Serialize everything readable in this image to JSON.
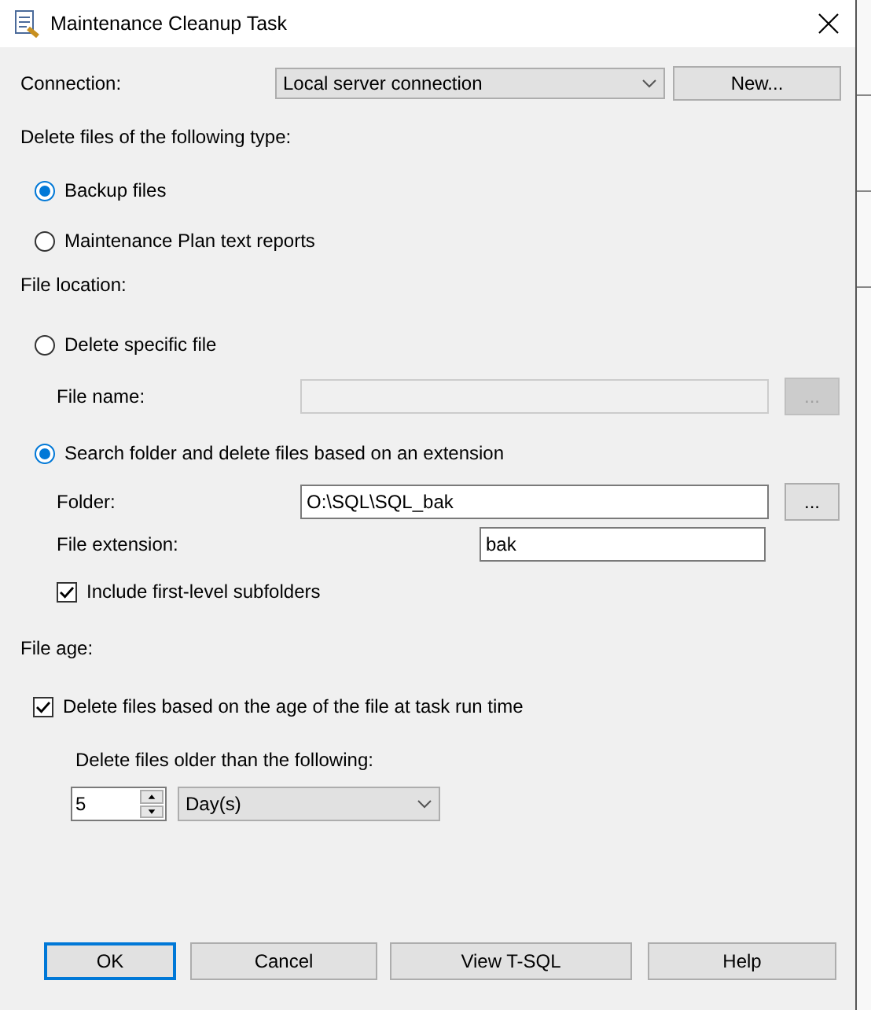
{
  "window": {
    "title": "Maintenance Cleanup Task"
  },
  "connection": {
    "label": "Connection:",
    "value": "Local server connection",
    "new_button": "New..."
  },
  "file_type": {
    "heading": "Delete files of the following type:",
    "options": [
      {
        "label": "Backup files",
        "selected": true
      },
      {
        "label": "Maintenance Plan text reports",
        "selected": false
      }
    ]
  },
  "file_location": {
    "heading": "File location:",
    "specific": {
      "label": "Delete specific file",
      "selected": false
    },
    "file_name": {
      "label": "File name:",
      "disabled": true,
      "browse": "..."
    },
    "search": {
      "label": "Search folder and delete files based on an extension",
      "selected": true
    },
    "folder": {
      "label": "Folder:",
      "value": "O:\\SQL\\SQL_bak",
      "browse": "..."
    },
    "extension": {
      "label": "File extension:",
      "value": "bak"
    },
    "subfolders": {
      "label": "Include first-level subfolders",
      "checked": true
    }
  },
  "file_age": {
    "heading": "File age:",
    "age_check": {
      "label": "Delete files based on the age of the file at task run time",
      "checked": true
    },
    "older_label": "Delete files older than the following:",
    "amount": "5",
    "unit": "Day(s)"
  },
  "buttons": [
    {
      "label": "OK",
      "default": true
    },
    {
      "label": "Cancel",
      "default": false
    },
    {
      "label": "View T-SQL",
      "default": false
    },
    {
      "label": "Help",
      "default": false
    }
  ]
}
